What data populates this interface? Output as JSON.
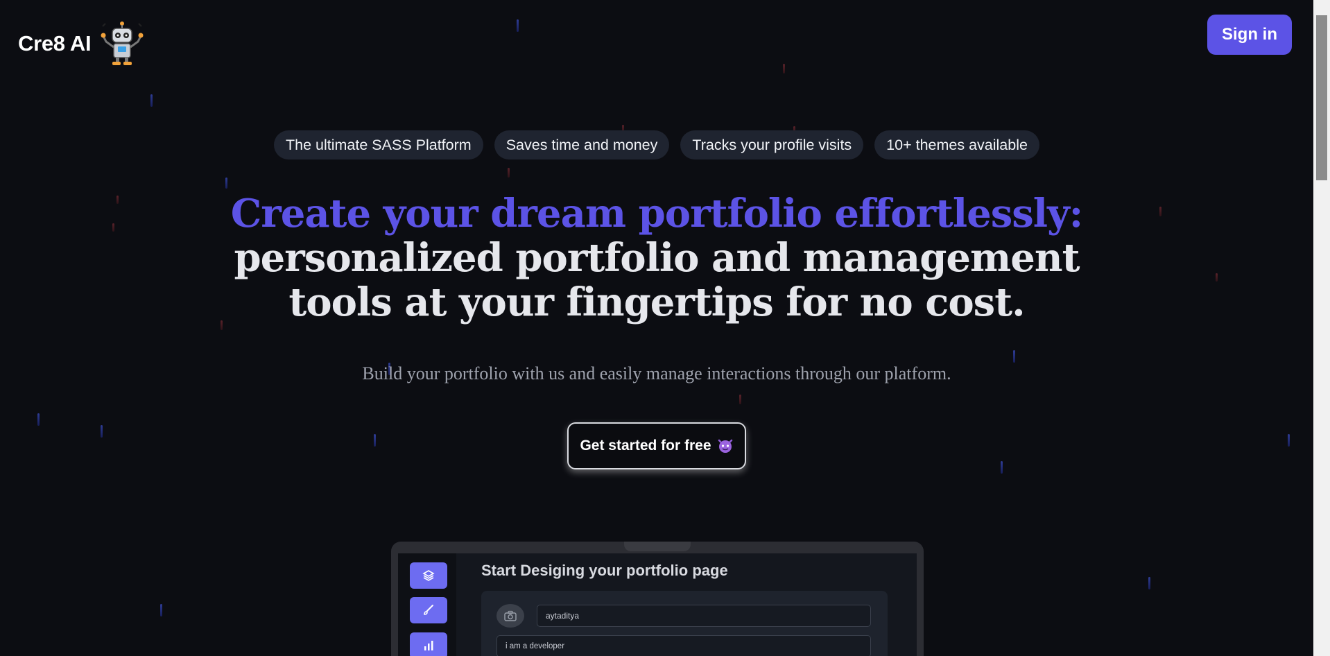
{
  "brand": {
    "name": "Cre8 AI",
    "mascot_icon": "robot-icon"
  },
  "header": {
    "signin_label": "Sign in"
  },
  "chips": [
    "The ultimate SASS Platform",
    "Saves time and money",
    "Tracks your profile visits",
    "10+ themes available"
  ],
  "hero": {
    "headline_accent": "Create your dream portfolio effortlessly:",
    "headline_rest": "personalized portfolio and management tools at your fingertips for no cost.",
    "subtitle": "Build your portfolio with us and easily manage interactions through our platform.",
    "cta_label": "Get started for free",
    "cta_icon": "smiling-devil-emoji"
  },
  "preview": {
    "title": "Start Desiging your portfolio page",
    "username_value": "aytaditya",
    "bio_value": "i am a developer",
    "sidebar_icons": [
      "layers-icon",
      "brush-icon",
      "chart-icon"
    ],
    "avatar_icon": "camera-icon"
  },
  "colors": {
    "background": "#0c0d12",
    "accent": "#5c53e6",
    "chip_bg": "#1f2430",
    "subtitle": "#9ea2ad"
  }
}
